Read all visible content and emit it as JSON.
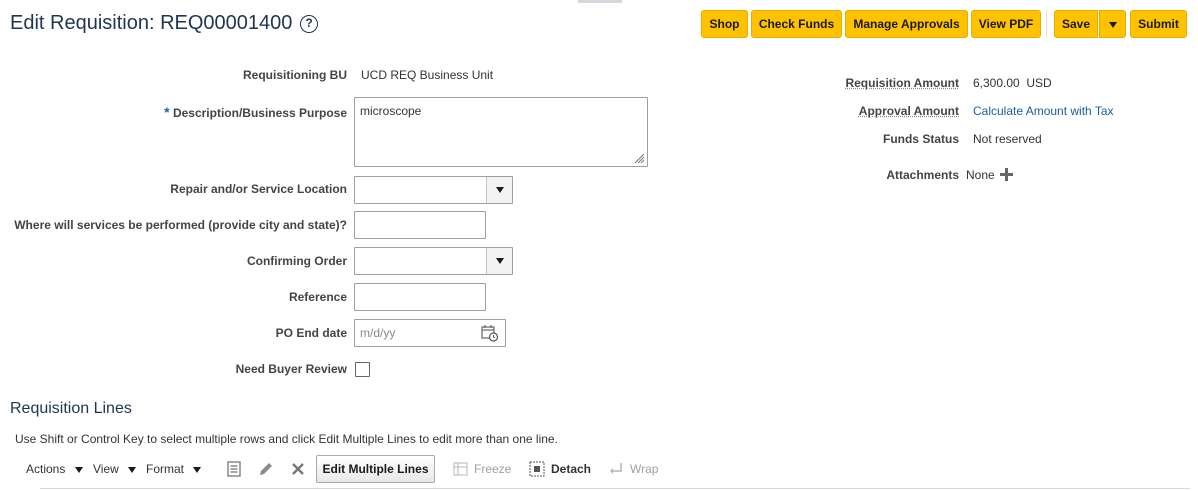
{
  "header": {
    "title": "Edit Requisition: REQ00001400",
    "help_icon": "question-circle-icon",
    "buttons": {
      "shop": "Shop",
      "check_funds": "Check Funds",
      "manage_approvals": "Manage Approvals",
      "view_pdf": "View PDF",
      "save": "Save",
      "submit": "Submit"
    }
  },
  "form": {
    "requisitioning_bu": {
      "label": "Requisitioning BU",
      "value": "UCD REQ Business Unit"
    },
    "description": {
      "required_marker": "*",
      "label": "Description/Business Purpose",
      "value": "microscope"
    },
    "repair_location": {
      "label": "Repair and/or Service Location",
      "value": ""
    },
    "services_location": {
      "label": "Where will services be performed (provide city and state)?",
      "value": ""
    },
    "confirming_order": {
      "label": "Confirming Order",
      "value": ""
    },
    "reference": {
      "label": "Reference",
      "value": ""
    },
    "po_end_date": {
      "label": "PO End date",
      "placeholder": "m/d/yy"
    },
    "need_buyer_review": {
      "label": "Need Buyer Review",
      "checked": false
    }
  },
  "summary": {
    "requisition_amount": {
      "label": "Requisition Amount",
      "value": "6,300.00",
      "currency": "USD"
    },
    "approval_amount": {
      "label": "Approval Amount",
      "link": "Calculate Amount with Tax"
    },
    "funds_status": {
      "label": "Funds Status",
      "value": "Not reserved"
    },
    "attachments": {
      "label": "Attachments",
      "value": "None",
      "add_icon": "plus-icon"
    }
  },
  "lines": {
    "title": "Requisition Lines",
    "instructions": "Use Shift or Control Key to select multiple rows and click Edit Multiple Lines to edit more than one line.",
    "toolbar": {
      "actions": "Actions",
      "view": "View",
      "format": "Format",
      "edit_multiple": "Edit Multiple Lines",
      "freeze": "Freeze",
      "detach": "Detach",
      "wrap": "Wrap"
    }
  },
  "colors": {
    "accent": "#ffc200",
    "title": "#1f3552",
    "link": "#1a5ea5",
    "required": "#1a66b3"
  }
}
